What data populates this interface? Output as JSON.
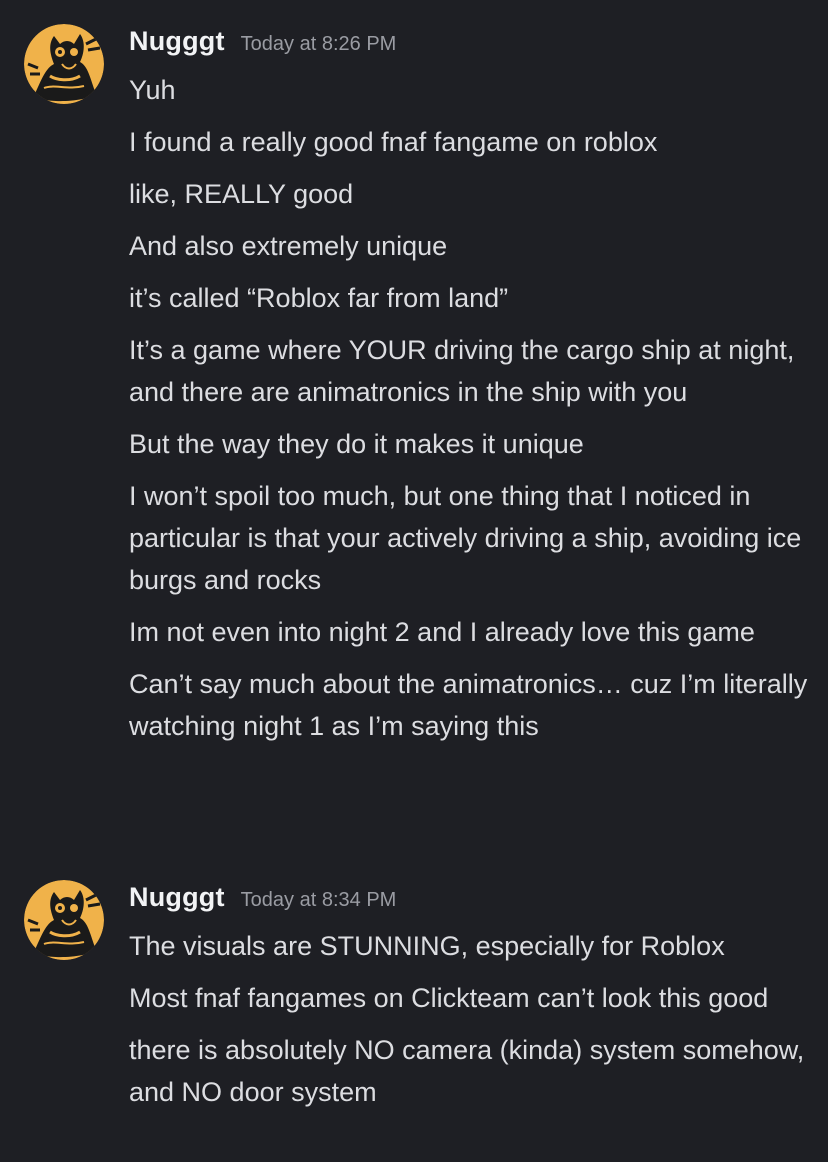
{
  "groups": [
    {
      "username": "Nugggt",
      "timestamp": "Today at 8:26 PM",
      "messages": [
        "Yuh",
        "I found a really good fnaf fangame on roblox",
        "like, REALLY good",
        "And also extremely unique",
        "it’s called “Roblox far from land”",
        "It’s a game where YOUR driving the cargo ship at night, and there are animatronics in the ship with you",
        "But the way they do it makes it unique",
        "I won’t spoil too much, but one thing that I noticed in particular is that your actively driving a ship, avoiding ice burgs and rocks",
        "Im not even into night 2 and I already love this game",
        "Can’t say much about the animatronics… cuz I’m literally watching night 1 as I’m saying this"
      ]
    },
    {
      "username": "Nugggt",
      "timestamp": "Today at 8:34 PM",
      "messages": [
        "The visuals are STUNNING, especially for Roblox",
        "Most fnaf fangames on Clickteam can’t look this good",
        "there is absolutely NO camera (kinda) system somehow, and NO door system"
      ]
    }
  ],
  "colors": {
    "background": "#1e1f24",
    "username": "#f2f3f5",
    "message_text": "#dcdde1",
    "timestamp": "#9a9ca3",
    "avatar_bg": "#f0b24a"
  },
  "icons": {
    "avatar": "user-avatar-cartoon-drawing"
  }
}
